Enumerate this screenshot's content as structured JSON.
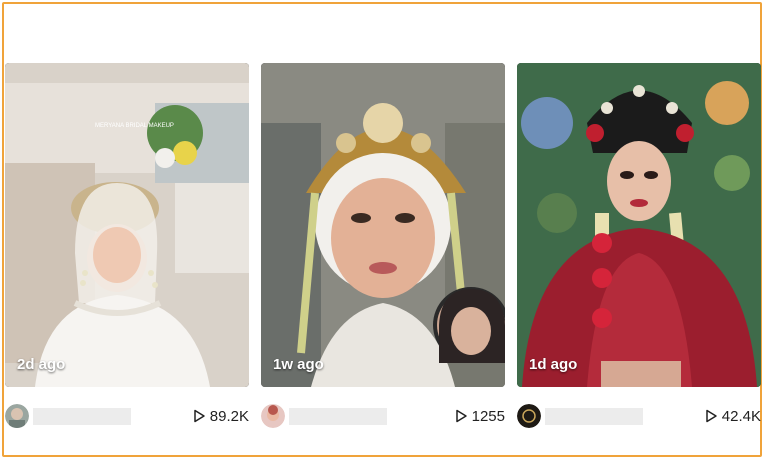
{
  "colors": {
    "frame": "#f0a33a",
    "card_bg": "#111111",
    "text": "#222222"
  },
  "cards": [
    {
      "age": "2d ago",
      "views": "89.2K",
      "overlay_text": "MERYANA BRIDAL MAKEUP",
      "avatar_icon": "avatar-photo",
      "name_hidden": true
    },
    {
      "age": "1w ago",
      "views": "1255",
      "overlay_text": "",
      "avatar_icon": "avatar-photo",
      "name_hidden": true
    },
    {
      "age": "1d ago",
      "views": "42.4K",
      "overlay_text": "",
      "avatar_icon": "avatar-photo",
      "name_hidden": true
    }
  ],
  "icons": {
    "play": "play-icon"
  }
}
